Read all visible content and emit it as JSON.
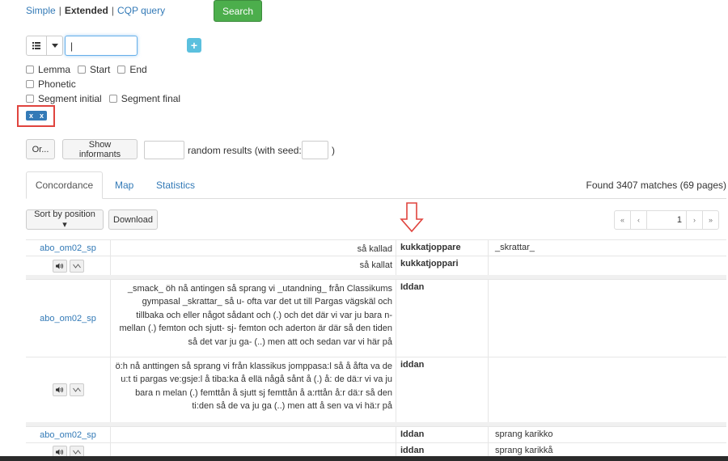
{
  "modes": {
    "simple": "Simple",
    "extended": "Extended",
    "cqp": "CQP query",
    "sep": "|"
  },
  "search_button": "Search",
  "token": {
    "input_value": "|",
    "plus": "+"
  },
  "checkboxes": {
    "row1": [
      "Lemma",
      "Start",
      "End"
    ],
    "row2": [
      "Phonetic"
    ],
    "row3": [
      "Segment initial",
      "Segment final"
    ]
  },
  "chip": {
    "a": "x",
    "b": "x"
  },
  "or_button": "Or...",
  "show_informants_button": "Show informants",
  "random_results_label": "random results (with seed:",
  "close_paren": ")",
  "tabs": {
    "concordance": "Concordance",
    "map": "Map",
    "statistics": "Statistics"
  },
  "found_text": "Found 3407 matches (69 pages)",
  "sort_button": "Sort by position ▾",
  "download_button": "Download",
  "pager": {
    "first": "«",
    "prev": "‹",
    "page": "1",
    "next": "›",
    "last": "»"
  },
  "rows": [
    {
      "speaker": "abo_om02_sp",
      "context": "så kallad",
      "match": "kukkatjoppare",
      "right": "_skrattar_"
    },
    {
      "speaker": "",
      "context": "så kallat",
      "match": "kukkatjoppari",
      "right": ""
    },
    {
      "speaker": "abo_om02_sp",
      "context": "_smack_ öh nå antingen så sprang vi _utandning_ från Classikums gympasal _skrattar_ så u- ofta var det ut till Pargas vägskäl och tillbaka och eller något sådant och (.) och det där vi var ju bara n- mellan (.) femton och sjutt- sj- femton och aderton är där så den tiden så det var ju ga- (..) men att och sedan var vi här på",
      "match": "Iddan",
      "right": ""
    },
    {
      "speaker": "",
      "context": "ö:h nå anttingen så sprang vi från klassikus jomppasa:l så å åfta va de u:t ti pargas ve:gsje:l å tiba:ka å ellä någå sånt å (.) å: de dä:r vi va ju bara n melan (.) femttån å sjutt sj femttån å a:rttån å:r dä:r så den ti:den så de va ju ga (..) men att å sen va vi hä:r på",
      "match": "iddan",
      "right": ""
    },
    {
      "speaker": "abo_om02_sp",
      "context": "",
      "match": "Iddan",
      "right": "sprang karikko"
    },
    {
      "speaker": "",
      "context": "",
      "match": "iddan",
      "right": "sprang karikkå"
    }
  ]
}
